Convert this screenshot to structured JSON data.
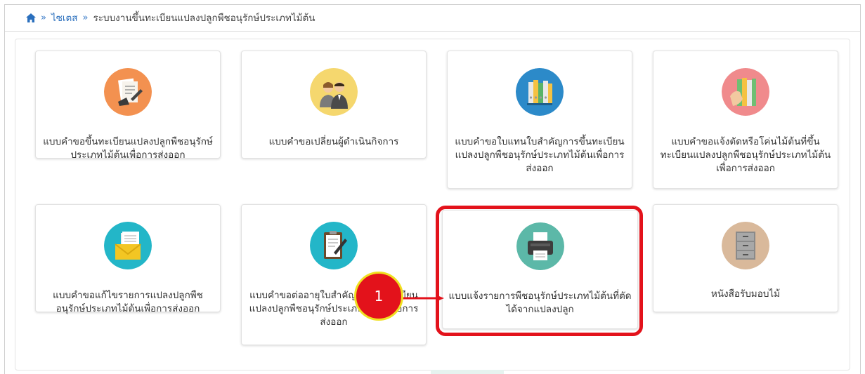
{
  "breadcrumb": {
    "separator": "»",
    "link": "ไซเตส",
    "current": "ระบบงานขึ้นทะเบียนแปลงปลูกพืชอนุรักษ์ประเภทไม้ต้น"
  },
  "cards": [
    {
      "label": "แบบคำขอขึ้นทะเบียนแปลงปลูกพืชอนุรักษ์ประเภทไม้ต้นเพื่อการส่งออก",
      "icon": "document-form-icon",
      "color": "#f39150"
    },
    {
      "label": "แบบคำขอเปลี่ยนผู้ดำเนินกิจการ",
      "icon": "business-people-icon",
      "color": "#f5d76e"
    },
    {
      "label": "แบบคำขอใบแทนใบสำคัญการขึ้นทะเบียนแปลงปลูกพืชอนุรักษ์ประเภทไม้ต้นเพื่อการส่งออก",
      "icon": "binders-icon",
      "color": "#2c8ac9"
    },
    {
      "label": "แบบคำขอแจ้งตัดหรือโค่นไม้ต้นที่ขึ้นทะเบียนแปลงปลูกพืชอนุรักษ์ประเภทไม้ต้นเพื่อการส่งออก",
      "icon": "binders-hand-icon",
      "color": "#f08a8c"
    },
    {
      "label": "แบบคำขอแก้ไขรายการแปลงปลูกพืชอนุรักษ์ประเภทไม้ต้นเพื่อการส่งออก",
      "icon": "envelope-letter-icon",
      "color": "#23b6c8"
    },
    {
      "label": "แบบคำขอต่ออายุใบสำคัญการขึ้นทะเบียนแปลงปลูกพืชอนุรักษ์ประเภทไม้ต้นเพื่อการส่งออก",
      "icon": "clipboard-pen-icon",
      "color": "#23b6c8"
    },
    {
      "label": "แบบแจ้งรายการพืชอนุรักษ์ประเภทไม้ต้นที่ตัดได้จากแปลงปลูก",
      "icon": "printer-icon",
      "color": "#5cb8a8"
    },
    {
      "label": "หนังสือรับมอบไม้",
      "icon": "file-cabinet-icon",
      "color": "#d9b99b"
    }
  ],
  "callout": {
    "number": "1",
    "color": "#e3121b"
  }
}
